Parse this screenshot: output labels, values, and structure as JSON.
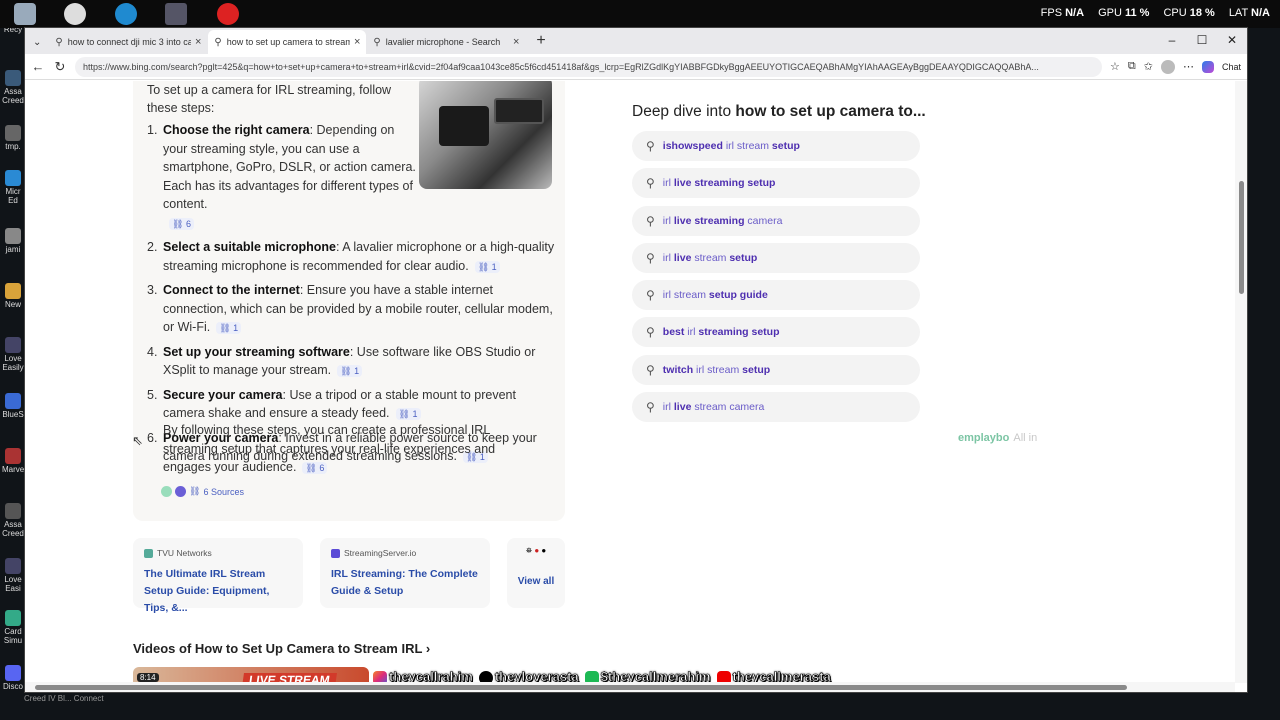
{
  "taskbar": {
    "fps_label": "FPS",
    "fps_value": "N/A",
    "gpu_label": "GPU",
    "gpu_value": "11 %",
    "cpu_label": "CPU",
    "cpu_value": "18 %",
    "lat_label": "LAT",
    "lat_value": "N/A"
  },
  "desktop_icons": [
    "Recy",
    "Assa Creed",
    "tmp.",
    "Micr Ed",
    "jami",
    "New",
    "Love Easily",
    "BlueS",
    "Marve",
    "Assa Creed",
    "Love Easi",
    "Card Simu",
    "Disco"
  ],
  "tabs": [
    {
      "title": "how to connect dji mic 3 into camera"
    },
    {
      "title": "how to set up camera to stream irl"
    },
    {
      "title": "lavalier microphone - Search"
    }
  ],
  "address": {
    "url": "https://www.bing.com/search?pglt=425&q=how+to+set+up+camera+to+stream+irl&cvid=2f04af9caa1043ce85c5f6cd451418af&gs_lcrp=EgRlZGdlKgYIABBFGDkyBggAEEUYOTIGCAEQABhAMgYIAhAAGEAyBggDEAAYQDIGCAQQABhA...",
    "chat": "Chat"
  },
  "answer": {
    "intro": "To set up a camera for IRL streaming, follow these steps:",
    "steps": [
      {
        "num": "1.",
        "title": "Choose the right camera",
        "text": ": Depending on your streaming style, you can use a smartphone, GoPro, DSLR, or action camera. Each has its advantages for different types of content.",
        "cite": "6"
      },
      {
        "num": "2.",
        "title": "Select a suitable microphone",
        "text": ": A lavalier microphone or a high-quality streaming microphone is recommended for clear audio.",
        "cite": "1"
      },
      {
        "num": "3.",
        "title": "Connect to the internet",
        "text": ": Ensure you have a stable internet connection, which can be provided by a mobile router, cellular modem, or Wi-Fi.",
        "cite": "1"
      },
      {
        "num": "4.",
        "title": "Set up your streaming software",
        "text": ": Use software like OBS Studio or XSplit to manage your stream.",
        "cite": "1"
      },
      {
        "num": "5.",
        "title": "Secure your camera",
        "text": ": Use a tripod or a stable mount to prevent camera shake and ensure a steady feed.",
        "cite": "1"
      },
      {
        "num": "6.",
        "title": "Power your camera",
        "text": ": Invest in a reliable power source to keep your camera running during extended streaming sessions.",
        "cite": "1"
      }
    ],
    "outro": "By following these steps, you can create a professional IRL streaming setup that captures your real-life experiences and engages your audience.",
    "outro_cite": "6",
    "sources": "6 Sources"
  },
  "source_cards": [
    {
      "site": "TVU Networks",
      "headline": "The Ultimate IRL Stream Setup Guide: Equipment, Tips, &..."
    },
    {
      "site": "StreamingServer.io",
      "headline": "IRL Streaming: The Complete Guide & Setup"
    }
  ],
  "view_all": "View all",
  "videos": {
    "heading": "Videos of How to Set Up Camera to Stream IRL",
    "duration": "8:14",
    "thumb_text": "LIVE STREAM"
  },
  "social": [
    "theycallrahim",
    "theyloverasta",
    "$theycallmerahim",
    "theycallmerasta"
  ],
  "deep_dive": {
    "prefix": "Deep dive into ",
    "query": "how to set up camera to..."
  },
  "related": [
    [
      {
        "t": "ishowspeed",
        "b": true
      },
      {
        "t": " irl stream ",
        "b": false
      },
      {
        "t": "setup",
        "b": true
      }
    ],
    [
      {
        "t": "irl ",
        "b": false
      },
      {
        "t": "live streaming setup",
        "b": true
      }
    ],
    [
      {
        "t": "irl ",
        "b": false
      },
      {
        "t": "live streaming",
        "b": true
      },
      {
        "t": " camera",
        "b": false
      }
    ],
    [
      {
        "t": "irl ",
        "b": false
      },
      {
        "t": "live",
        "b": true
      },
      {
        "t": " stream ",
        "b": false
      },
      {
        "t": "setup",
        "b": true
      }
    ],
    [
      {
        "t": "irl stream ",
        "b": false
      },
      {
        "t": "setup guide",
        "b": true
      }
    ],
    [
      {
        "t": "best",
        "b": true
      },
      {
        "t": " irl ",
        "b": false
      },
      {
        "t": "streaming setup",
        "b": true
      }
    ],
    [
      {
        "t": "twitch",
        "b": true
      },
      {
        "t": " irl stream ",
        "b": false
      },
      {
        "t": "setup",
        "b": true
      }
    ],
    [
      {
        "t": "irl ",
        "b": false
      },
      {
        "t": "live",
        "b": true
      },
      {
        "t": " stream camera",
        "b": false
      }
    ]
  ],
  "watermark": {
    "brand": "emplaybo",
    "tail": "All in"
  },
  "bottom": "Creed IV Bl...     Connect"
}
